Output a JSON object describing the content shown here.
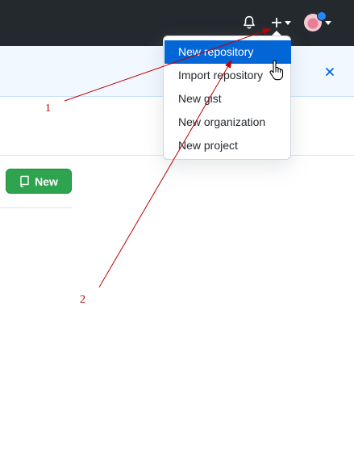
{
  "dropdown": {
    "items": [
      {
        "label": "New repository"
      },
      {
        "label": "Import repository"
      },
      {
        "label": "New gist"
      },
      {
        "label": "New organization"
      },
      {
        "label": "New project"
      }
    ]
  },
  "buttons": {
    "new_label": "New"
  },
  "annotations": {
    "marker_1": "1",
    "marker_2": "2"
  },
  "colors": {
    "header": "#24292e",
    "banner": "#f1f8ff",
    "accent": "#0366d6",
    "new_button": "#2ea44f",
    "annotation": "#c00000"
  },
  "icons": [
    "bell-icon",
    "plus-icon",
    "caret-down-icon",
    "avatar",
    "close-icon",
    "repo-icon",
    "hand-cursor-icon"
  ]
}
